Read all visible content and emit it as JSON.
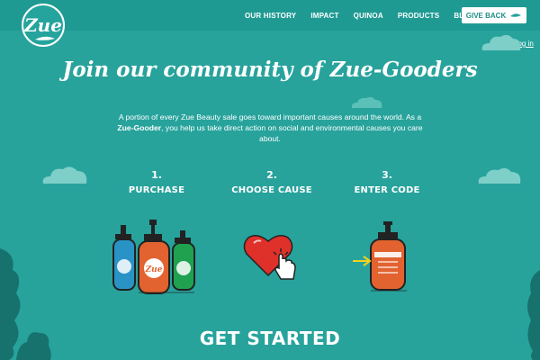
{
  "brand": {
    "logo_text": "Zue"
  },
  "nav": {
    "items": [
      "OUR HISTORY",
      "IMPACT",
      "QUINOA",
      "PRODUCTS",
      "BLOG"
    ],
    "give_back": "GIVE BACK"
  },
  "account": {
    "login": "Log in"
  },
  "hero": {
    "title": "Join our community of Zue-Gooders",
    "intro_before": "A portion of every Zue Beauty sale goes toward important causes around the world. As a ",
    "intro_bold": "Zue-Gooder",
    "intro_after": ", you help us take direct action on social and environmental causes you care about."
  },
  "steps": [
    {
      "number": "1.",
      "label": "PURCHASE",
      "icon": "bottles-icon"
    },
    {
      "number": "2.",
      "label": "CHOOSE CAUSE",
      "icon": "heart-click-icon"
    },
    {
      "number": "3.",
      "label": "ENTER CODE",
      "icon": "bottle-code-icon"
    }
  ],
  "cta": {
    "label": "GET STARTED"
  },
  "colors": {
    "background": "#27a39c",
    "topbar": "#1f9a93",
    "bottle_orange": "#e2632f",
    "bottle_blue": "#2a93c6",
    "bottle_green": "#1fa150",
    "heart_red": "#e0302a",
    "arrow_yellow": "#f4d21e"
  }
}
